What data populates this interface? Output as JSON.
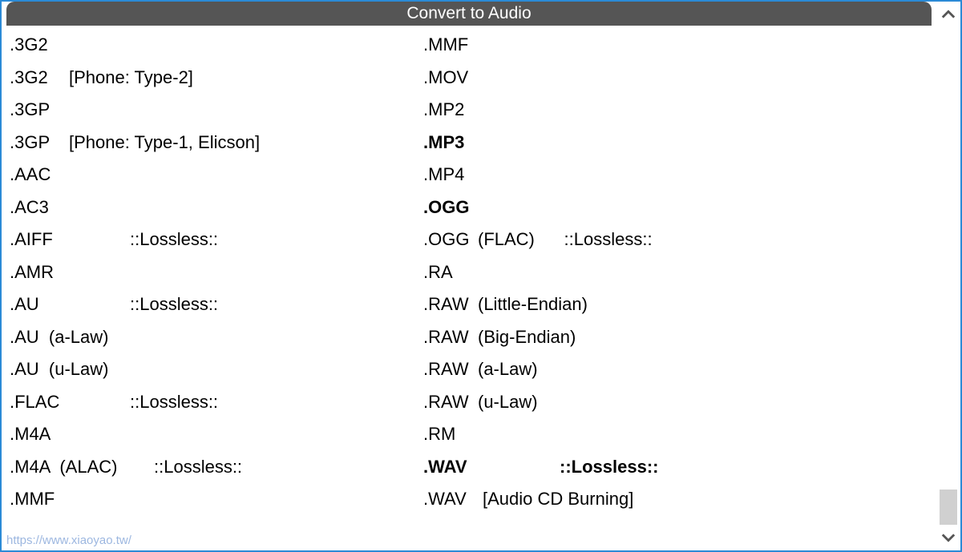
{
  "header": {
    "title": "Convert to Audio"
  },
  "columns": {
    "left": [
      {
        "ext": ".3G2",
        "suffix": "",
        "bold": false,
        "extClass": ""
      },
      {
        "ext": ".3G2",
        "suffix": "[Phone: Type-2]",
        "bold": false,
        "extClass": "w-3g2"
      },
      {
        "ext": ".3GP",
        "suffix": "",
        "bold": false,
        "extClass": ""
      },
      {
        "ext": ".3GP",
        "suffix": "[Phone: Type-1, Elicson]",
        "bold": false,
        "extClass": "w-3gp"
      },
      {
        "ext": ".AAC",
        "suffix": "",
        "bold": false,
        "extClass": ""
      },
      {
        "ext": ".AC3",
        "suffix": "",
        "bold": false,
        "extClass": ""
      },
      {
        "ext": ".AIFF",
        "suffix": "::Lossless::",
        "bold": false,
        "extClass": "w-aiff"
      },
      {
        "ext": ".AMR",
        "suffix": "",
        "bold": false,
        "extClass": ""
      },
      {
        "ext": ".AU",
        "suffix": "::Lossless::",
        "bold": false,
        "extClass": "w-au"
      },
      {
        "ext": ".AU  (a-Law)",
        "suffix": "",
        "bold": false,
        "extClass": ""
      },
      {
        "ext": ".AU  (u-Law)",
        "suffix": "",
        "bold": false,
        "extClass": ""
      },
      {
        "ext": ".FLAC",
        "suffix": "::Lossless::",
        "bold": false,
        "extClass": "w-flac"
      },
      {
        "ext": ".M4A",
        "suffix": "",
        "bold": false,
        "extClass": ""
      },
      {
        "ext": ".M4A  (ALAC)",
        "suffix": "::Lossless::",
        "bold": false,
        "extClass": "w-m4a-alac"
      },
      {
        "ext": ".MMF",
        "suffix": "",
        "bold": false,
        "extClass": ""
      }
    ],
    "right": [
      {
        "ext": ".MMF",
        "suffix": "",
        "bold": false,
        "extClass": ""
      },
      {
        "ext": ".MOV",
        "suffix": "",
        "bold": false,
        "extClass": ""
      },
      {
        "ext": ".MP2",
        "suffix": "",
        "bold": false,
        "extClass": ""
      },
      {
        "ext": ".MP3",
        "suffix": "",
        "bold": true,
        "extClass": ""
      },
      {
        "ext": ".MP4",
        "suffix": "",
        "bold": false,
        "extClass": ""
      },
      {
        "ext": ".OGG",
        "suffix": "",
        "bold": true,
        "extClass": ""
      },
      {
        "ext": ".OGG",
        "suffix": "(FLAC)      ::Lossless::",
        "bold": false,
        "extClass": "w-ogg"
      },
      {
        "ext": ".RA",
        "suffix": "",
        "bold": false,
        "extClass": ""
      },
      {
        "ext": ".RAW",
        "suffix": "(Little-Endian)",
        "bold": false,
        "extClass": "w-raw"
      },
      {
        "ext": ".RAW",
        "suffix": "(Big-Endian)",
        "bold": false,
        "extClass": "w-raw"
      },
      {
        "ext": ".RAW",
        "suffix": "(a-Law)",
        "bold": false,
        "extClass": "w-raw"
      },
      {
        "ext": ".RAW",
        "suffix": "(u-Law)",
        "bold": false,
        "extClass": "w-raw"
      },
      {
        "ext": ".RM",
        "suffix": "",
        "bold": false,
        "extClass": ""
      },
      {
        "ext": ".WAV",
        "suffix": "::Lossless::",
        "bold": true,
        "extClass": "w-wav"
      },
      {
        "ext": ".WAV",
        "suffix": "[Audio CD Burning]",
        "bold": false,
        "extClass": "w-wav2"
      }
    ]
  },
  "watermark": "https://www.xiaoyao.tw/"
}
